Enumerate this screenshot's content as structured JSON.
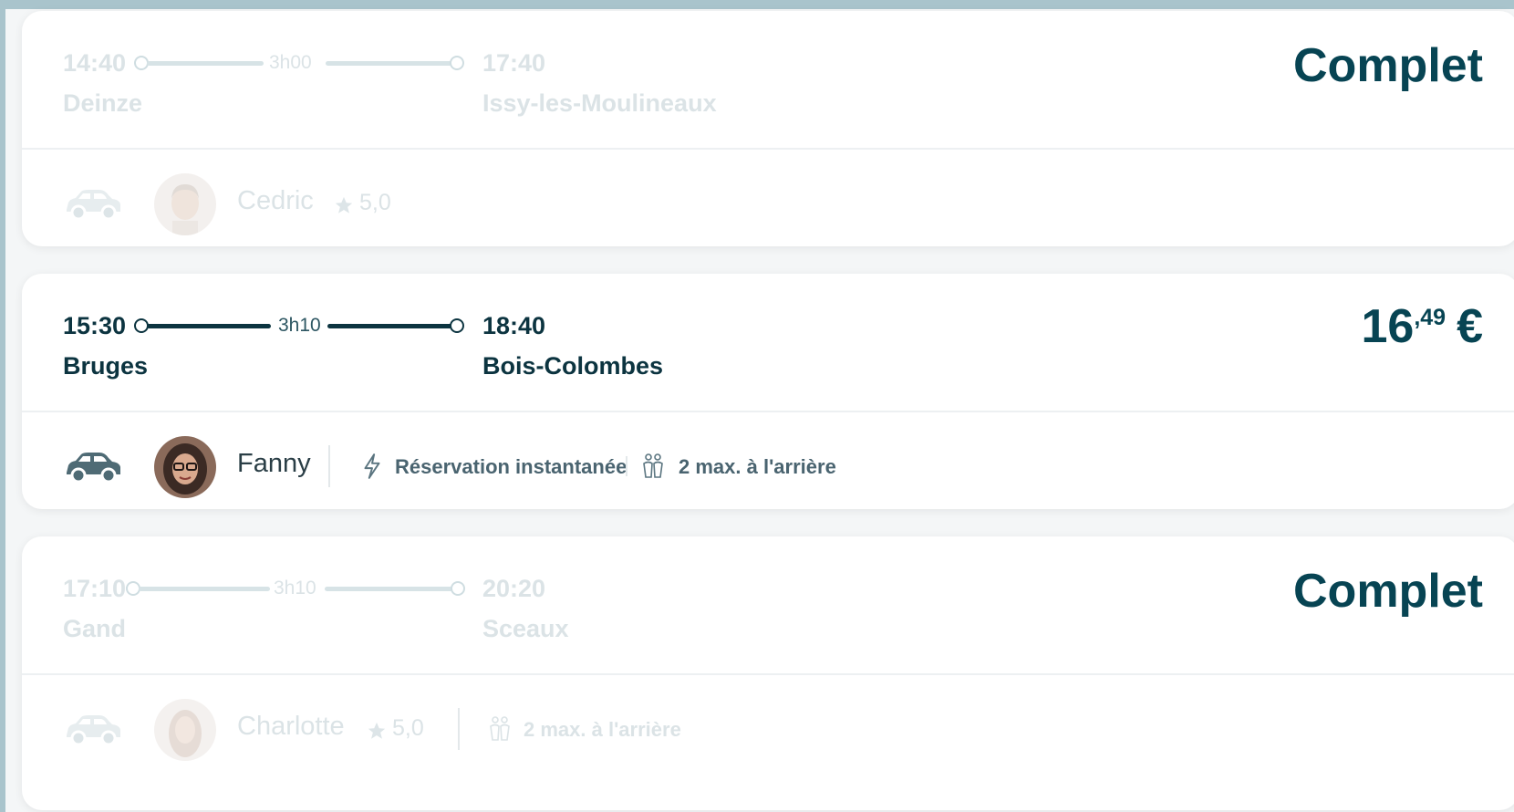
{
  "trips": [
    {
      "state": "full",
      "departure_time": "14:40",
      "arrival_time": "17:40",
      "duration": "3h00",
      "departure_city": "Deinze",
      "arrival_city": "Issy-les-Moulineaux",
      "status": "Complet",
      "driver": "Cedric",
      "rating": "5,0"
    },
    {
      "state": "available",
      "departure_time": "15:30",
      "arrival_time": "18:40",
      "duration": "3h10",
      "departure_city": "Bruges",
      "arrival_city": "Bois-Colombes",
      "price_int": "16",
      "price_dec": ",49",
      "currency": "€",
      "driver": "Fanny",
      "feature_instant": "Réservation instantanée",
      "feature_seats": "2 max. à l'arrière"
    },
    {
      "state": "full",
      "departure_time": "17:10",
      "arrival_time": "20:20",
      "duration": "3h10",
      "departure_city": "Gand",
      "arrival_city": "Sceaux",
      "status": "Complet",
      "driver": "Charlotte",
      "rating": "5,0",
      "feature_seats": "2 max. à l'arrière"
    }
  ],
  "icons": {
    "car": "car-icon",
    "star": "star-icon",
    "lightning": "lightning-icon",
    "seats": "back-seats-icon"
  },
  "colors": {
    "primary": "#074453",
    "faded": "#dbe3e6",
    "background": "#a9c4cc"
  }
}
